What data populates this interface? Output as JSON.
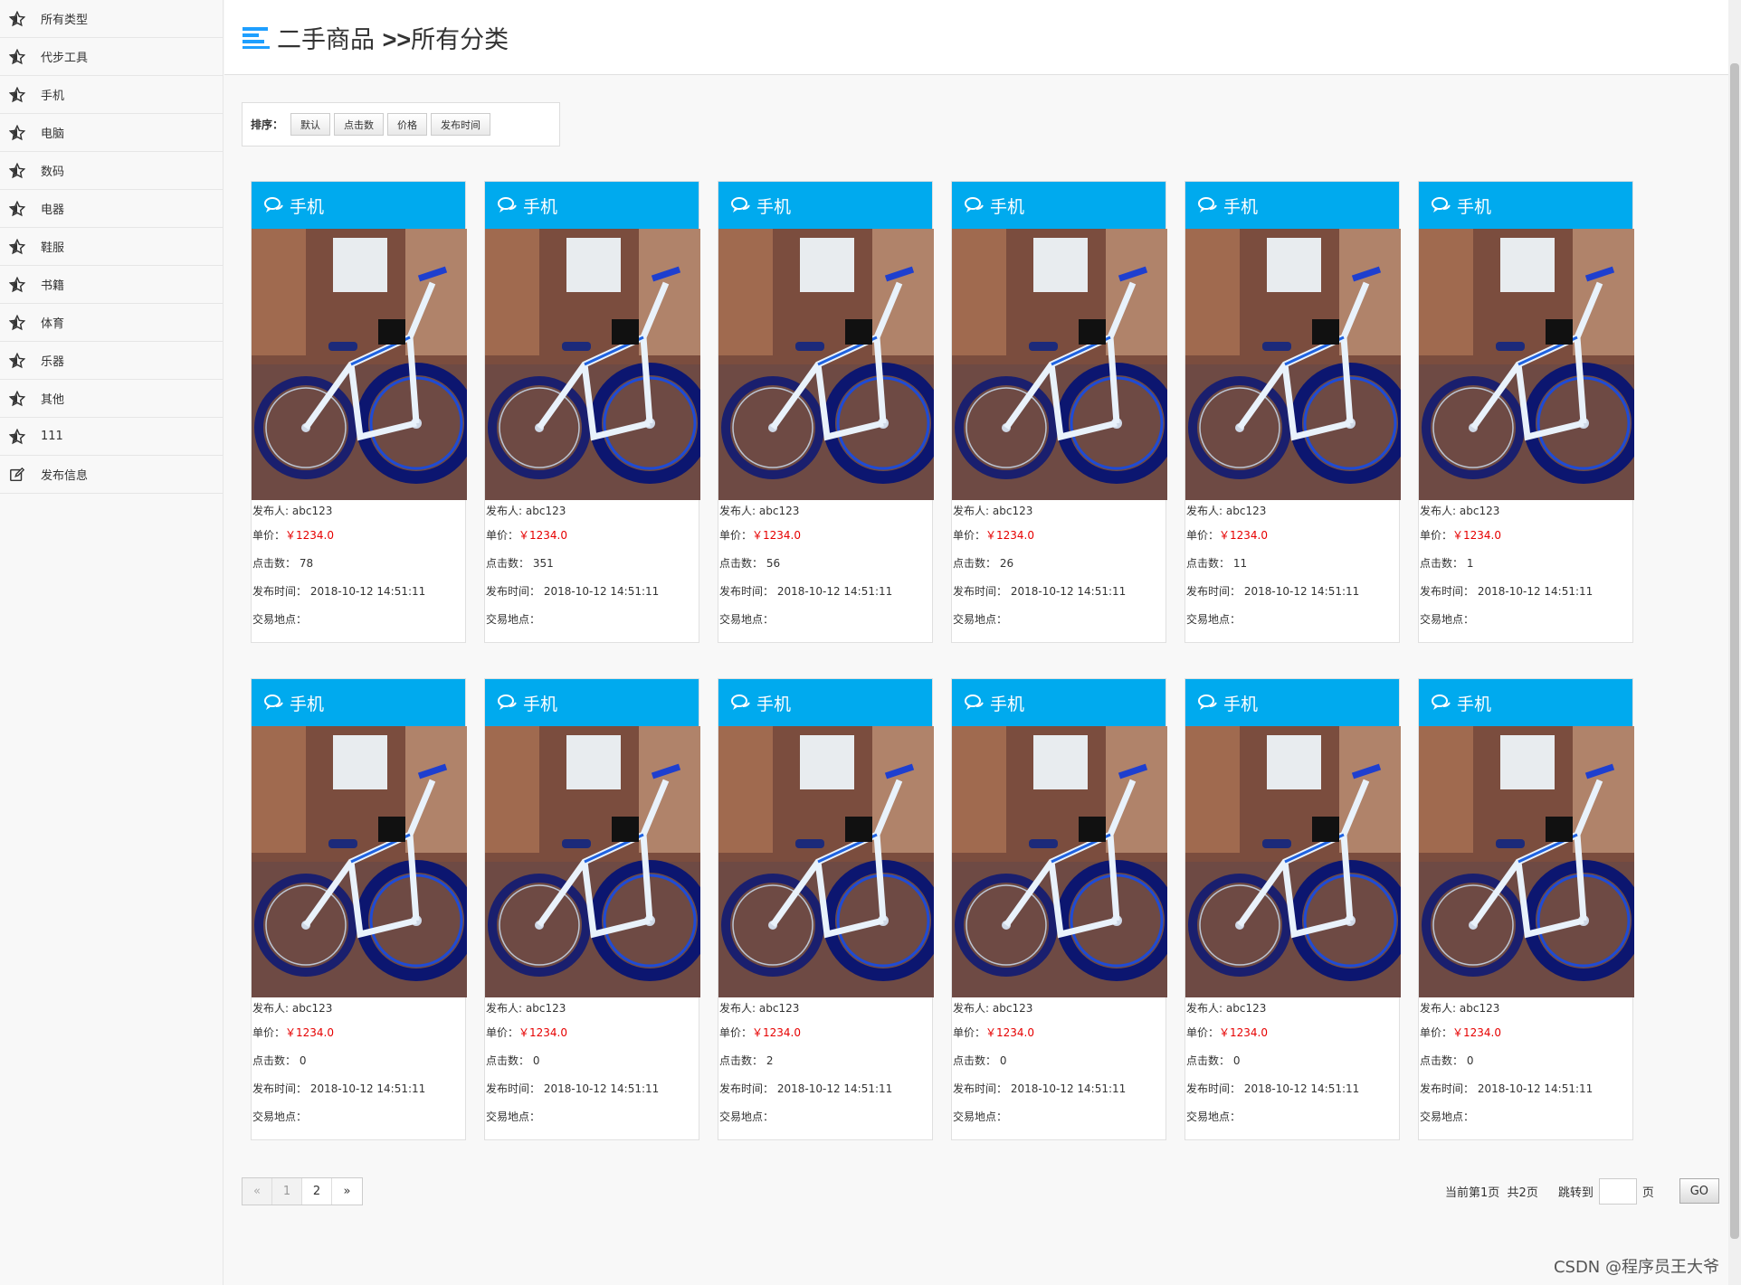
{
  "sidebar": {
    "items": [
      {
        "label": "所有类型",
        "icon": "star-icon"
      },
      {
        "label": "代步工具",
        "icon": "star-icon"
      },
      {
        "label": "手机",
        "icon": "star-icon"
      },
      {
        "label": "电脑",
        "icon": "star-icon"
      },
      {
        "label": "数码",
        "icon": "star-icon"
      },
      {
        "label": "电器",
        "icon": "star-icon"
      },
      {
        "label": "鞋服",
        "icon": "star-icon"
      },
      {
        "label": "书籍",
        "icon": "star-icon"
      },
      {
        "label": "体育",
        "icon": "star-icon"
      },
      {
        "label": "乐器",
        "icon": "star-icon"
      },
      {
        "label": "其他",
        "icon": "star-icon"
      },
      {
        "label": "111",
        "icon": "star-icon"
      },
      {
        "label": "发布信息",
        "icon": "edit-icon"
      }
    ]
  },
  "header": {
    "title_main": "二手商品",
    "title_sep": ">>",
    "title_sub": "所有分类"
  },
  "sort": {
    "label": "排序：",
    "buttons": [
      "默认",
      "点击数",
      "价格",
      "发布时间"
    ]
  },
  "card_labels": {
    "publisher": "发布人:",
    "price": "单价：",
    "clicks": "点击数：",
    "time": "发布时间：",
    "location": "交易地点："
  },
  "products": [
    {
      "category": "手机",
      "publisher": "abc123",
      "price": "￥1234.0",
      "clicks": "78",
      "time": "2018-10-12 14:51:11",
      "location": ""
    },
    {
      "category": "手机",
      "publisher": "abc123",
      "price": "￥1234.0",
      "clicks": "351",
      "time": "2018-10-12 14:51:11",
      "location": ""
    },
    {
      "category": "手机",
      "publisher": "abc123",
      "price": "￥1234.0",
      "clicks": "56",
      "time": "2018-10-12 14:51:11",
      "location": ""
    },
    {
      "category": "手机",
      "publisher": "abc123",
      "price": "￥1234.0",
      "clicks": "26",
      "time": "2018-10-12 14:51:11",
      "location": ""
    },
    {
      "category": "手机",
      "publisher": "abc123",
      "price": "￥1234.0",
      "clicks": "11",
      "time": "2018-10-12 14:51:11",
      "location": ""
    },
    {
      "category": "手机",
      "publisher": "abc123",
      "price": "￥1234.0",
      "clicks": "1",
      "time": "2018-10-12 14:51:11",
      "location": ""
    },
    {
      "category": "手机",
      "publisher": "abc123",
      "price": "￥1234.0",
      "clicks": "0",
      "time": "2018-10-12 14:51:11",
      "location": ""
    },
    {
      "category": "手机",
      "publisher": "abc123",
      "price": "￥1234.0",
      "clicks": "0",
      "time": "2018-10-12 14:51:11",
      "location": ""
    },
    {
      "category": "手机",
      "publisher": "abc123",
      "price": "￥1234.0",
      "clicks": "2",
      "time": "2018-10-12 14:51:11",
      "location": ""
    },
    {
      "category": "手机",
      "publisher": "abc123",
      "price": "￥1234.0",
      "clicks": "0",
      "time": "2018-10-12 14:51:11",
      "location": ""
    },
    {
      "category": "手机",
      "publisher": "abc123",
      "price": "￥1234.0",
      "clicks": "0",
      "time": "2018-10-12 14:51:11",
      "location": ""
    },
    {
      "category": "手机",
      "publisher": "abc123",
      "price": "￥1234.0",
      "clicks": "0",
      "time": "2018-10-12 14:51:11",
      "location": ""
    }
  ],
  "pagination": {
    "prev": "«",
    "pages": [
      "1",
      "2"
    ],
    "current": "1",
    "next": "»",
    "current_text": "当前第1页",
    "total_text": "共2页",
    "jump_label": "跳转到",
    "page_suffix": "页",
    "go_label": "GO"
  },
  "watermark": "CSDN @程序员王大爷",
  "colors": {
    "card_header": "#00aaee",
    "price": "#e60000",
    "title_icon": "#1e9fff"
  }
}
